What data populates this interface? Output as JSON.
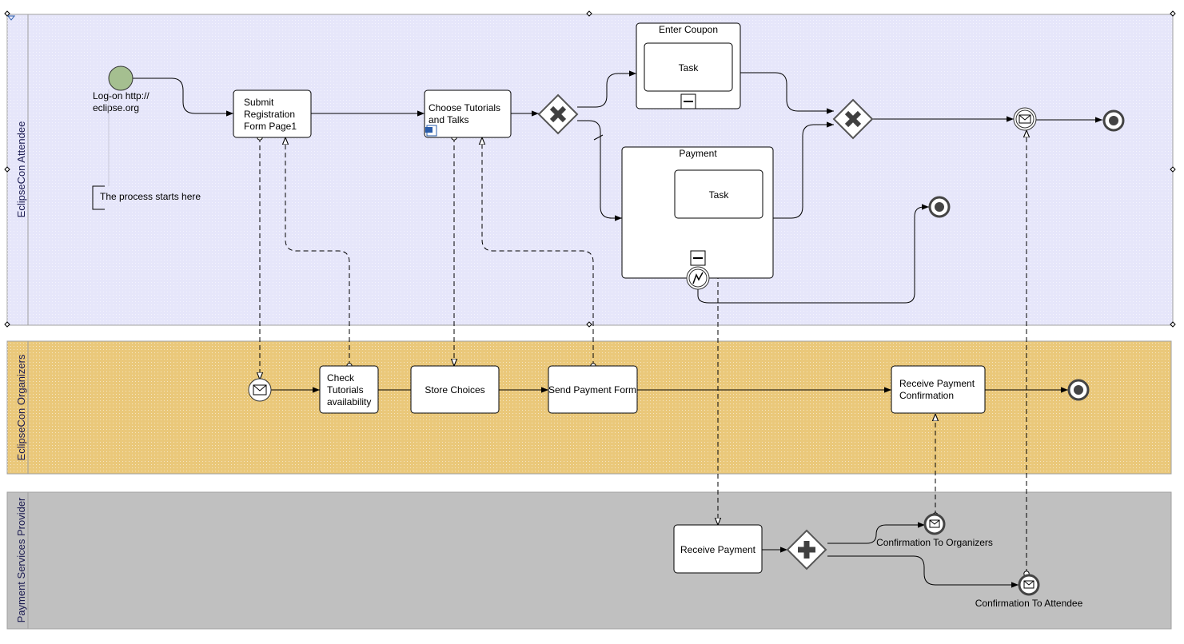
{
  "lanes": [
    {
      "name": "EclipseCon Attendee",
      "color": "#E6E6FA"
    },
    {
      "name": "EclipseCon Organizers",
      "color": "#EAC87A"
    },
    {
      "name": "Payment Services Provider",
      "color": "#C0C0C0"
    }
  ],
  "attendee": {
    "start_event_label_1": "Log-on http://",
    "start_event_label_2": "eclipse.org",
    "annotation": "The process starts here",
    "submit_task": [
      "Submit",
      "Registration",
      "Form Page1"
    ],
    "choose_task": [
      "Choose Tutorials",
      "and Talks"
    ],
    "enter_coupon": {
      "title": "Enter Coupon",
      "task": "Task"
    },
    "payment": {
      "title": "Payment",
      "task": "Task"
    }
  },
  "organizers": {
    "check_task": [
      "Check",
      "Tutorials",
      "availability"
    ],
    "store_task": "Store Choices",
    "send_task": "Send Payment Form",
    "receive_confirm_task": [
      "Receive Payment",
      "Confirmation"
    ]
  },
  "provider": {
    "receive_payment_task": "Receive Payment",
    "confirm_organizers": "Confirmation To Organizers",
    "confirm_attendee": "Confirmation To Attendee"
  },
  "colors": {
    "start_event": "#A5BF90",
    "gateway_marker": "#404040"
  },
  "icons": [
    "message-icon",
    "exclusive-gateway-icon",
    "parallel-gateway-icon",
    "end-event-icon",
    "error-event-icon",
    "collapse-icon",
    "word-document-icon"
  ]
}
